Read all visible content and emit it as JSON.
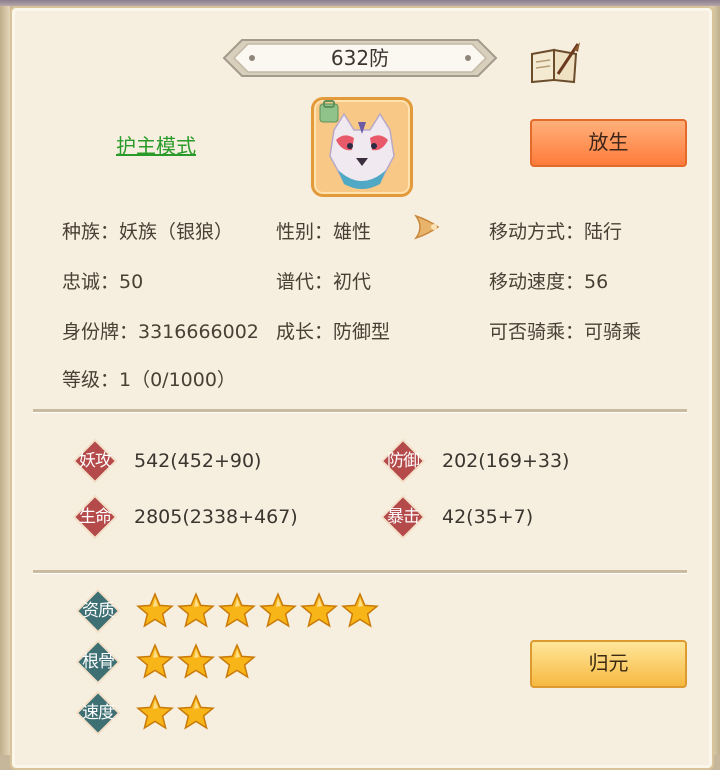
{
  "pet": {
    "name": "632防",
    "guard_mode_label": "护主模式",
    "release_label": "放生",
    "return_label": "归元",
    "portrait_icon": "silver-wolf-portrait"
  },
  "info": {
    "race": "种族：妖族（银狼）",
    "gender": "性别：雄性",
    "move_type": "移动方式：陆行",
    "loyalty": "忠诚：50",
    "generation": "谱代：初代",
    "move_speed": "移动速度：56",
    "id_tag": "身份牌：3316666002",
    "growth": "成长：防御型",
    "rideable": "可否骑乘：可骑乘",
    "level": "等级：1（0/1000）"
  },
  "stats": [
    {
      "label": "妖攻",
      "value": "542(452+90)"
    },
    {
      "label": "防御",
      "value": "202(169+33)"
    },
    {
      "label": "生命",
      "value": "2805(2338+467)"
    },
    {
      "label": "暴击",
      "value": "42(35+7)"
    }
  ],
  "aptitudes": [
    {
      "label": "资质",
      "stars": 6
    },
    {
      "label": "根骨",
      "stars": 3
    },
    {
      "label": "速度",
      "stars": 2
    }
  ],
  "colors": {
    "guard_mode": "#2a9b2a",
    "stat_badge": "#b44a4a",
    "apt_badge": "#3e6f73",
    "star": "#f7b518",
    "release_button": "#ff8a4a",
    "return_button": "#f8cf5e"
  }
}
